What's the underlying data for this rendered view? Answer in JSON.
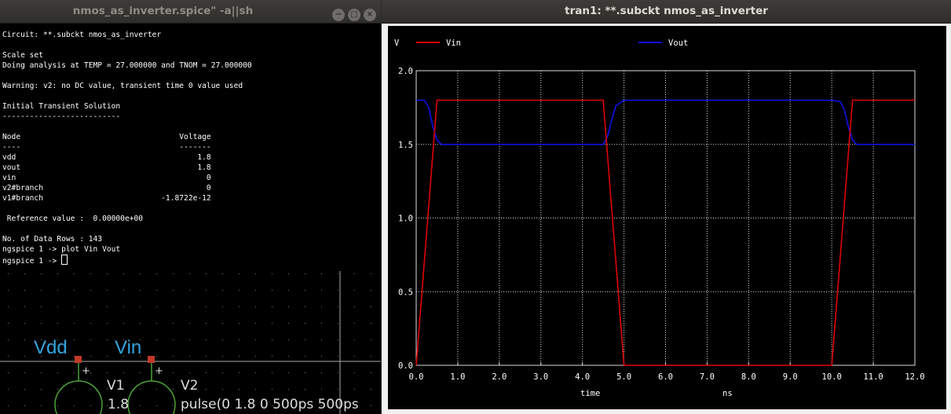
{
  "terminal_window": {
    "title": "nmos_as_inverter.spice\" -a||sh",
    "buttons": [
      "minimize",
      "maximize",
      "close"
    ],
    "lines": [
      "Circuit: **.subckt nmos_as_inverter",
      "",
      "Scale set",
      "Doing analysis at TEMP = 27.000000 and TNOM = 27.000000",
      "",
      "Warning: v2: no DC value, transient time 0 value used",
      "",
      "Initial Transient Solution",
      "--------------------------",
      "",
      "Node                                   Voltage",
      "----                                   -------",
      "vdd                                        1.8",
      "vout                                       1.8",
      "vin                                          0",
      "v2#branch                                    0",
      "v1#branch                          -1.8722e-12",
      "",
      " Reference value :  0.00000e+00",
      "",
      "No. of Data Rows : 143",
      "ngspice 1 -> plot Vin Vout",
      "ngspice 1 -> "
    ]
  },
  "schematic": {
    "labels": [
      "Vdd",
      "Vin"
    ],
    "sources": [
      {
        "name": "V1",
        "value": "1.8"
      },
      {
        "name": "V2",
        "value": "pulse(0 1.8 0 500ps 500ps"
      }
    ],
    "plus_sign": "+",
    "label_color": "#33a6e0",
    "wire_color": "#4aa336",
    "pin_color": "#c0392b"
  },
  "plot_window": {
    "title": "tran1: **.subckt nmos_as_inverter"
  },
  "chart_data": {
    "type": "line",
    "ylabel": "V",
    "xlabel": "time",
    "xunit": "ns",
    "xlim": [
      0,
      12
    ],
    "ylim": [
      0,
      2
    ],
    "xticks": [
      "0.0",
      "1.0",
      "2.0",
      "3.0",
      "4.0",
      "5.0",
      "6.0",
      "7.0",
      "8.0",
      "9.0",
      "10.0",
      "11.0",
      "12.0"
    ],
    "yticks": [
      "0.0",
      "0.5",
      "1.0",
      "1.5",
      "2.0"
    ],
    "grid": true,
    "series": [
      {
        "name": "Vin",
        "color": "#e00000",
        "x": [
          0,
          0.5,
          4.5,
          5.0,
          10.0,
          10.5,
          12.0
        ],
        "y": [
          0,
          1.8,
          1.8,
          0,
          0,
          1.8,
          1.8
        ]
      },
      {
        "name": "Vout",
        "color": "#1010e8",
        "x": [
          0,
          0.2,
          0.3,
          0.4,
          0.5,
          0.6,
          4.5,
          4.6,
          4.7,
          4.8,
          5.0,
          10.0,
          10.2,
          10.3,
          10.4,
          10.5,
          10.6,
          12.0
        ],
        "y": [
          1.8,
          1.8,
          1.75,
          1.62,
          1.53,
          1.5,
          1.5,
          1.55,
          1.66,
          1.76,
          1.8,
          1.8,
          1.79,
          1.74,
          1.62,
          1.53,
          1.5,
          1.5
        ]
      }
    ]
  }
}
